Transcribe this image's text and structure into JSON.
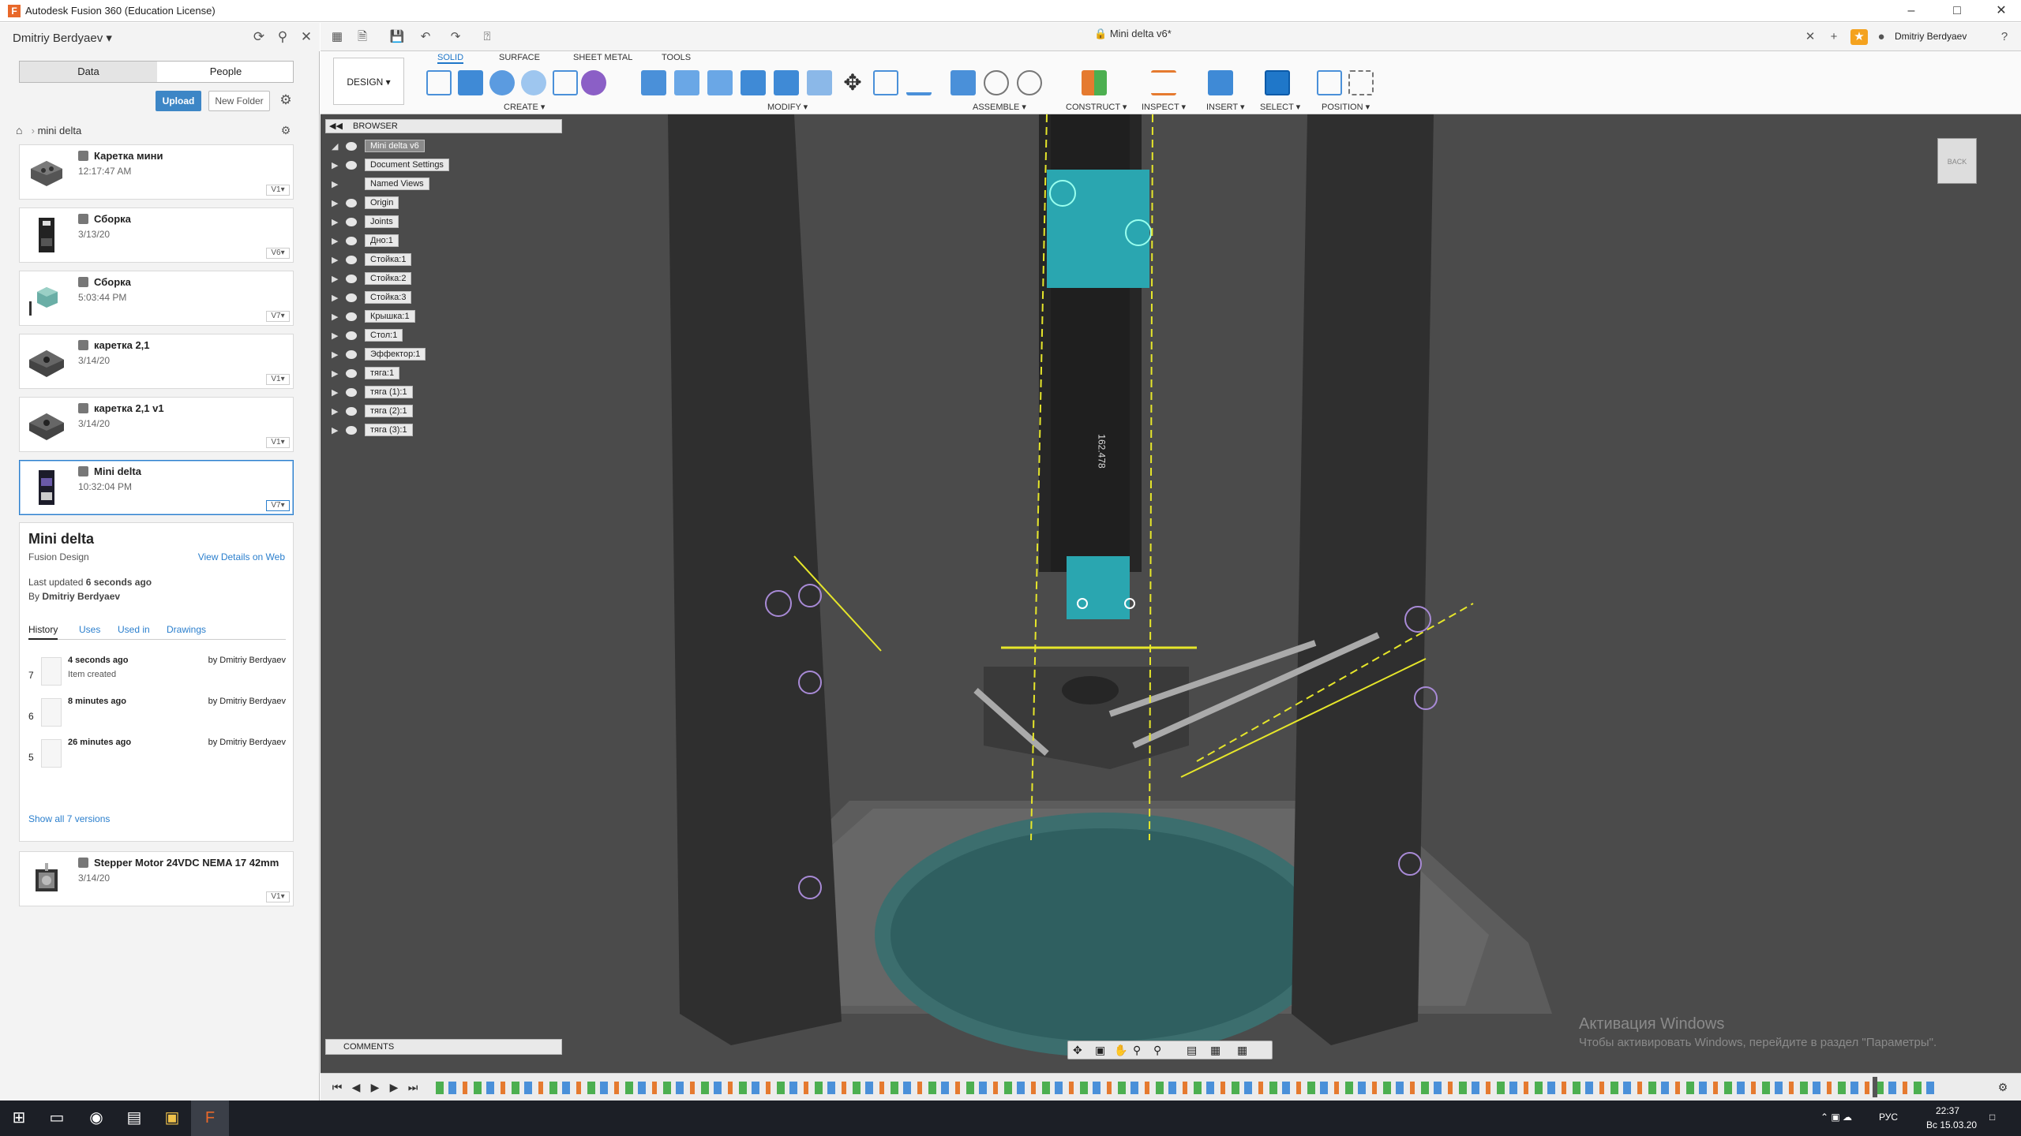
{
  "window": {
    "title": "Autodesk Fusion 360 (Education License)"
  },
  "data_panel": {
    "user": "Dmitriy Berdyaev",
    "tabs": [
      "Data",
      "People"
    ],
    "upload_label": "Upload",
    "new_folder_label": "New Folder",
    "breadcrumb": "mini delta",
    "files": [
      {
        "name": "Каретка мини",
        "date": "12:17:47 AM",
        "version": "V1"
      },
      {
        "name": "Сборка",
        "date": "3/13/20",
        "version": "V6"
      },
      {
        "name": "Сборка",
        "date": "5:03:44 PM",
        "version": "V7"
      },
      {
        "name": "каретка 2,1",
        "date": "3/14/20",
        "version": "V1"
      },
      {
        "name": "каретка 2,1 v1",
        "date": "3/14/20",
        "version": "V1"
      },
      {
        "name": "Mini delta",
        "date": "10:32:04 PM",
        "version": "V7"
      }
    ],
    "details": {
      "name": "Mini delta",
      "type": "Fusion Design",
      "view_web": "View Details on Web",
      "last_updated_label": "Last updated",
      "last_updated_value": "6 seconds ago",
      "by_label": "By",
      "by_value": "Dmitriy Berdyaev",
      "tabs": [
        "History",
        "Uses",
        "Used in",
        "Drawings"
      ],
      "history": [
        {
          "num": "7",
          "when": "4 seconds ago",
          "who": "by Dmitriy Berdyaev",
          "note": "Item created"
        },
        {
          "num": "6",
          "when": "8 minutes ago",
          "who": "by Dmitriy Berdyaev",
          "note": ""
        },
        {
          "num": "5",
          "when": "26 minutes ago",
          "who": "by Dmitriy Berdyaev",
          "note": ""
        }
      ],
      "show_all": "Show all 7 versions"
    },
    "extra_file": {
      "name": "Stepper Motor 24VDC NEMA 17 42mm",
      "date": "3/14/20",
      "version": "V1"
    }
  },
  "doc_tab": {
    "title": "Mini delta v6*",
    "user": "Dmitriy Berdyaev"
  },
  "toolbar": {
    "workspace": "DESIGN",
    "ribbon_tabs": [
      "SOLID",
      "SURFACE",
      "SHEET METAL",
      "TOOLS"
    ],
    "groups": [
      "CREATE",
      "MODIFY",
      "ASSEMBLE",
      "CONSTRUCT",
      "INSPECT",
      "INSERT",
      "SELECT",
      "POSITION"
    ]
  },
  "browser": {
    "title": "BROWSER",
    "root": "Mini delta v6",
    "nodes": [
      "Document Settings",
      "Named Views",
      "Origin",
      "Joints",
      "Дно:1",
      "Стойка:1",
      "Стойка:2",
      "Стойка:3",
      "Крышка:1",
      "Стол:1",
      "Эффектор:1",
      "тяга:1",
      "тяга (1):1",
      "тяга (2):1",
      "тяга (3):1"
    ]
  },
  "canvas": {
    "dimension_text": "162.478",
    "comments_label": "COMMENTS",
    "viewcube_label": "BACK",
    "watermark_title": "Активация Windows",
    "watermark_sub": "Чтобы активировать Windows, перейдите в раздел \"Параметры\"."
  },
  "taskbar": {
    "time": "22:37",
    "date": "Вс 15.03.20",
    "lang": "РУС"
  },
  "colors": {
    "accent": "#1f77c9",
    "model_teal": "#2aa6b0",
    "canvas_bg": "#4b4b4b",
    "sketch_yellow": "#e6e62a"
  }
}
